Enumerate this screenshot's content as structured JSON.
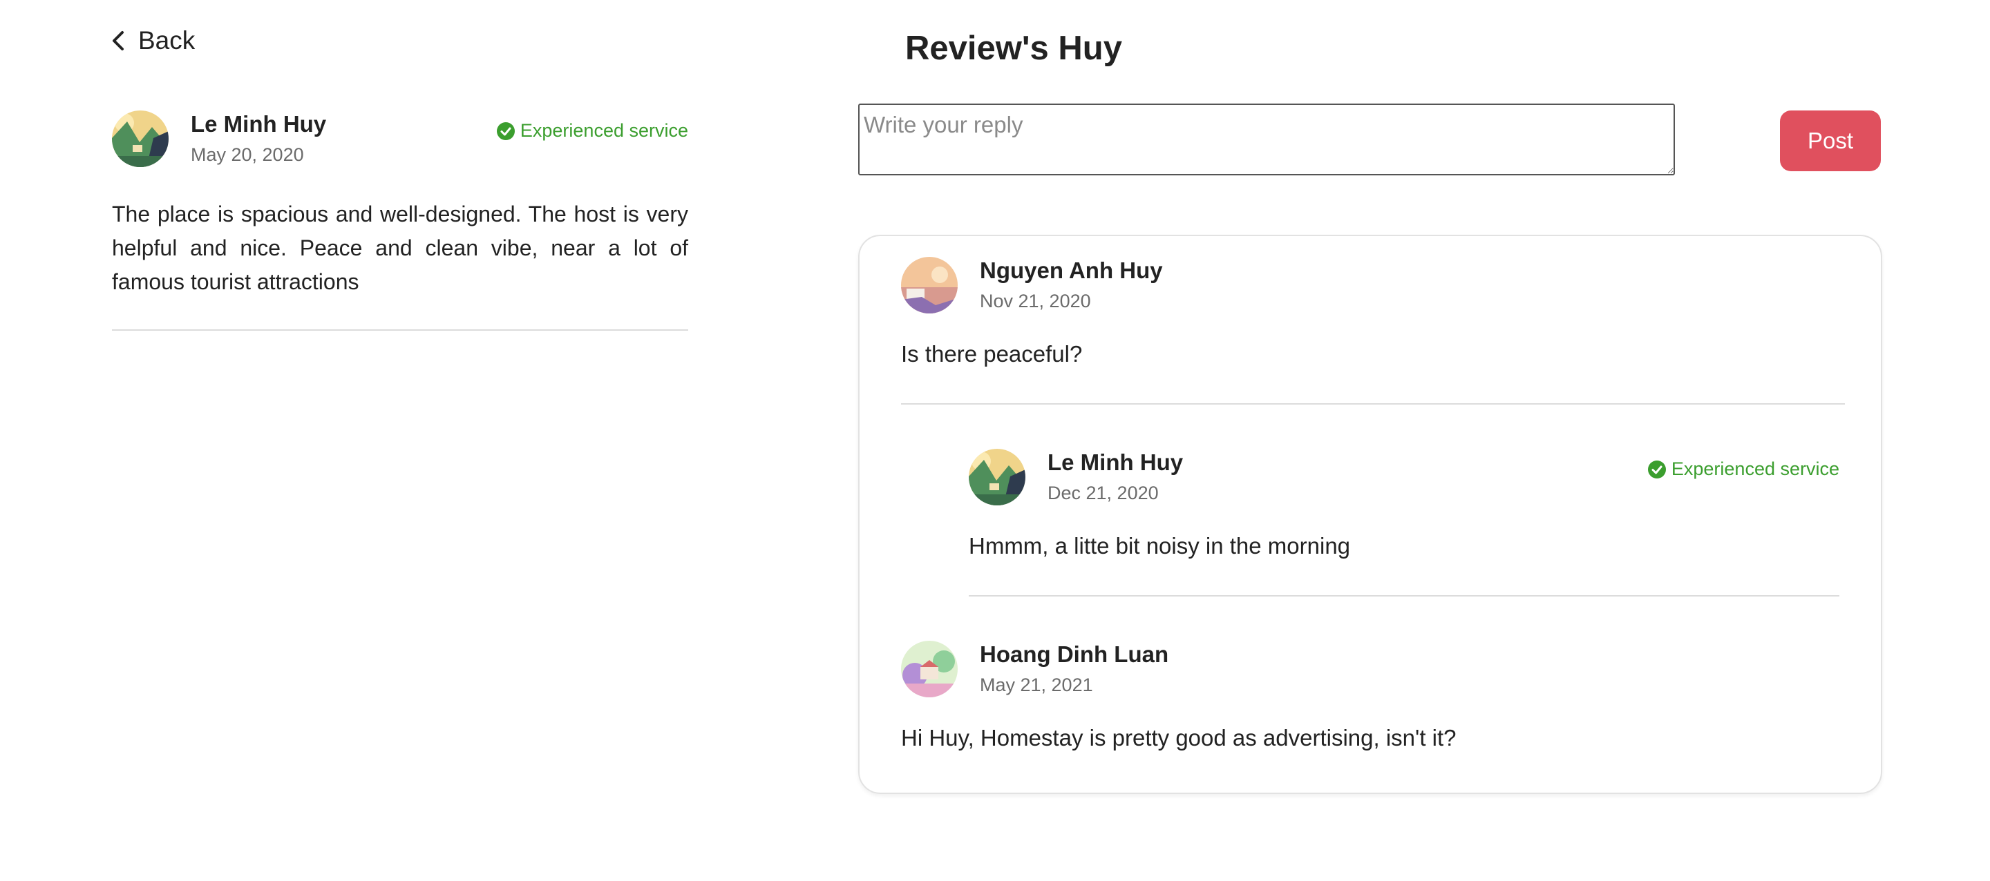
{
  "nav": {
    "back_label": "Back"
  },
  "page": {
    "title": "Review's Huy"
  },
  "review": {
    "author": "Le Minh Huy",
    "date": "May 20, 2020",
    "badge": "Experienced service",
    "text": "The place is spacious and well-designed. The host is very helpful and nice. Peace and clean vibe, near a lot of famous tourist attractions"
  },
  "reply_form": {
    "value": "",
    "placeholder": "Write your reply",
    "post_label": "Post"
  },
  "comments": [
    {
      "author": "Nguyen Anh Huy",
      "date": "Nov 21, 2020",
      "text": "Is there peaceful?"
    },
    {
      "author": "Le Minh Huy",
      "date": "Dec 21, 2020",
      "badge": "Experienced service",
      "text": "Hmmm, a litte bit noisy in the morning"
    },
    {
      "author": "Hoang Dinh Luan",
      "date": "May 21, 2021",
      "text": "Hi Huy, Homestay is pretty good as advertising, isn't it?"
    }
  ],
  "colors": {
    "accent": "#e0505e",
    "badge_green": "#3b9e2e",
    "text": "#222222",
    "muted": "#6b6b6b",
    "divider": "#dcdcdc"
  },
  "icons": {
    "back": "chevron-left-icon",
    "badge": "check-circle-icon"
  }
}
